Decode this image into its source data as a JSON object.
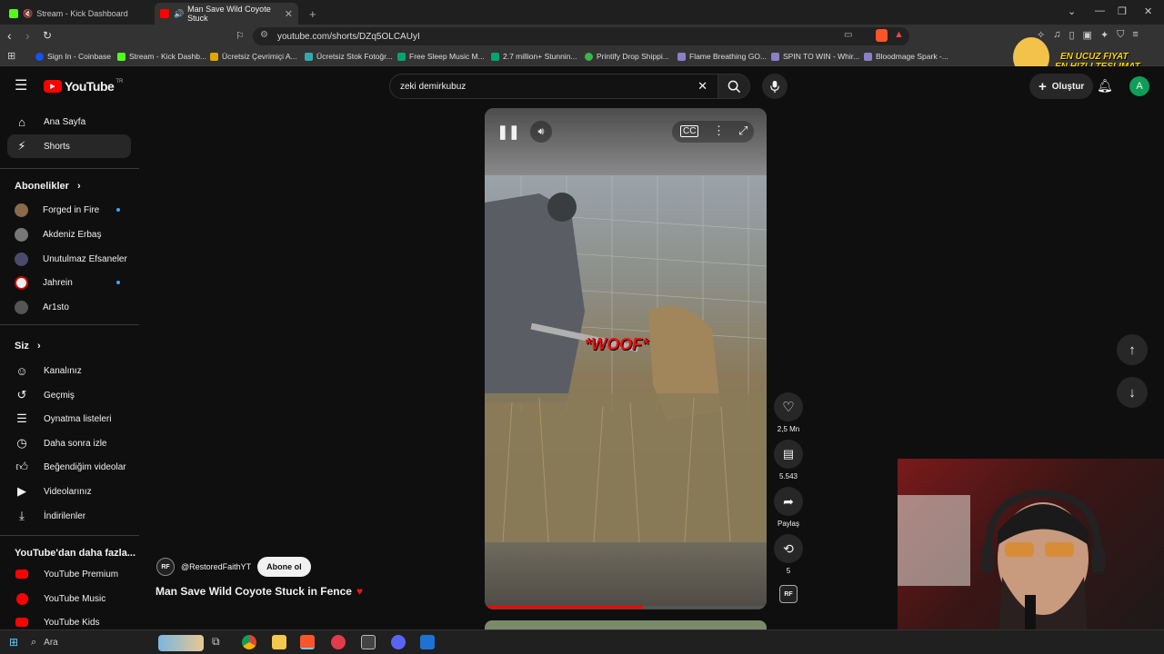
{
  "browser": {
    "tabs": [
      {
        "title": "Stream - Kick Dashboard",
        "active": false
      },
      {
        "title": "Man Save Wild Coyote Stuck",
        "active": true
      }
    ],
    "url": "youtube.com/shorts/DZq5OLCAUyI",
    "bookmarks": [
      "Sign In - Coinbase",
      "Stream - Kick Dashb...",
      "Ücretsiz Çevrimiçi A...",
      "Ücretsiz Stok Fotoğr...",
      "Free Sleep Music M...",
      "2.7 million+ Stunnin...",
      "Printify Drop Shippi...",
      "Flame Breathing GO...",
      "SPIN TO WIN - Whir...",
      "Bloodmage Spark -..."
    ],
    "promo": [
      "EN UCUZ FIYAT",
      "EN HIZLI TESLIMAT"
    ]
  },
  "youtube": {
    "logo_text": "YouTube",
    "logo_region": "TR",
    "search_value": "zeki demirkubuz",
    "create_label": "Oluştur",
    "avatar_letter": "A",
    "sidebar": {
      "main": [
        "Ana Sayfa",
        "Shorts"
      ],
      "subs_title": "Abonelikler",
      "subs": [
        "Forged in Fire",
        "Akdeniz Erbaş",
        "Unutulmaz Efsaneler",
        "Jahrein",
        "Ar1sto"
      ],
      "you_title": "Siz",
      "you_items": [
        "Kanalınız",
        "Geçmiş",
        "Oynatma listeleri",
        "Daha sonra izle",
        "Beğendiğim videolar",
        "Videolarınız",
        "İndirilenler"
      ],
      "more_title": "YouTube'dan daha fazla...",
      "more_items": [
        "YouTube Premium",
        "YouTube Music",
        "YouTube Kids"
      ]
    },
    "short": {
      "channel": "@RestoredFaithYT",
      "subscribe": "Abone ol",
      "title": "Man Save Wild Coyote Stuck in Fence",
      "overlay_text": "*WOOF*",
      "channel_badge": "RF",
      "likes": "2,5 Mn",
      "comments": "5.543",
      "share": "Paylaş",
      "remix": "5",
      "progress": 0.56
    }
  },
  "taskbar": {
    "search": "Ara"
  },
  "colors": {
    "youtube_red": "#ff0000",
    "accent_blue": "#3ea6ff",
    "avatar": "#0f9d58"
  }
}
